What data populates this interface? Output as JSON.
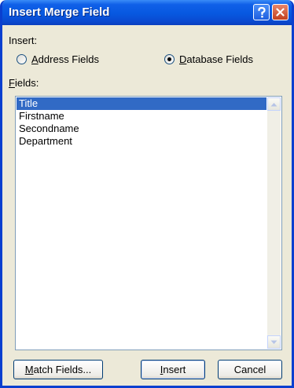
{
  "window": {
    "title": "Insert Merge Field",
    "help_glyph": "?",
    "close_glyph": "✕"
  },
  "insert": {
    "label": "Insert:",
    "options": [
      {
        "label_accel": "A",
        "label_rest": "ddress Fields",
        "checked": false
      },
      {
        "label_accel": "D",
        "label_rest": "atabase Fields",
        "checked": true
      }
    ]
  },
  "fields": {
    "label_accel": "F",
    "label_rest": "ields:",
    "items": [
      "Title",
      "Firstname",
      "Secondname",
      "Department"
    ],
    "selected_index": 0
  },
  "buttons": {
    "match_accel": "M",
    "match_rest": "atch Fields...",
    "insert_accel": "I",
    "insert_rest": "nsert",
    "cancel": "Cancel"
  },
  "colors": {
    "titlebar": "#0758e0",
    "selection": "#316ac5",
    "dialog_bg": "#ece9d8"
  }
}
